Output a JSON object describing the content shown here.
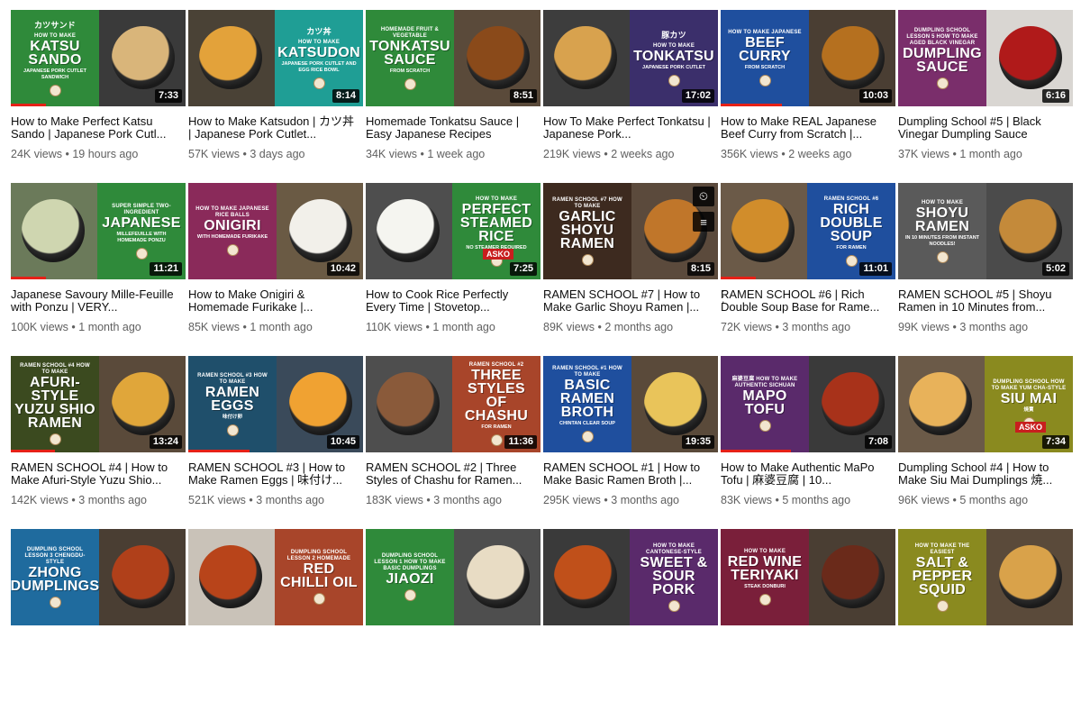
{
  "videos": [
    {
      "title": "How to Make Perfect Katsu Sando | Japanese Pork Cutl...",
      "views": "24K views",
      "age": "19 hours ago",
      "duration": "7:33",
      "thumb_text": {
        "small": "HOW TO MAKE",
        "big": "KATSU SANDO",
        "sub": "JAPANESE PORK CUTLET SANDWICH",
        "jp": "カツサンド"
      },
      "colors": {
        "panel": "#2f8a3a",
        "bg": "#3a3a3a",
        "food": "#d9b57a"
      },
      "progress": 0.2,
      "panel_side": "left"
    },
    {
      "title": "How to Make Katsudon | カツ丼 | Japanese Pork Cutlet...",
      "views": "57K views",
      "age": "3 days ago",
      "duration": "8:14",
      "thumb_text": {
        "small": "HOW TO MAKE",
        "big": "KATSUDON",
        "sub": "JAPANESE PORK CUTLET AND EGG RICE BOWL",
        "jp": "カツ丼"
      },
      "colors": {
        "panel": "#1f9e95",
        "bg": "#4a4236",
        "food": "#e3a23a"
      },
      "progress": 0.0,
      "panel_side": "right"
    },
    {
      "title": "Homemade Tonkatsu Sauce | Easy Japanese Recipes",
      "views": "34K views",
      "age": "1 week ago",
      "duration": "8:51",
      "thumb_text": {
        "small": "HOMEMADE FRUIT & VEGETABLE",
        "big": "TONKATSU SAUCE",
        "sub": "FROM SCRATCH",
        "jp": ""
      },
      "colors": {
        "panel": "#2f8a3a",
        "bg": "#5a4a3a",
        "food": "#8a4a1a"
      },
      "progress": 0.0,
      "panel_side": "left"
    },
    {
      "title": "How To Make Perfect Tonkatsu | Japanese Pork...",
      "views": "219K views",
      "age": "2 weeks ago",
      "duration": "17:02",
      "thumb_text": {
        "small": "HOW TO MAKE",
        "big": "TONKATSU",
        "sub": "JAPANESE PORK CUTLET",
        "jp": "豚カツ"
      },
      "colors": {
        "panel": "#3b2f6b",
        "bg": "#3d3d3d",
        "food": "#d8a24e"
      },
      "progress": 0.0,
      "panel_side": "right"
    },
    {
      "title": "How to Make REAL Japanese Beef Curry from Scratch |...",
      "views": "356K views",
      "age": "2 weeks ago",
      "duration": "10:03",
      "thumb_text": {
        "small": "HOW TO MAKE JAPANESE",
        "big": "BEEF CURRY",
        "sub": "FROM SCRATCH",
        "jp": ""
      },
      "colors": {
        "panel": "#1f4f9e",
        "bg": "#4a3e33",
        "food": "#b5701f"
      },
      "progress": 0.35,
      "panel_side": "left"
    },
    {
      "title": "Dumpling School #5 | Black Vinegar Dumpling Sauce",
      "views": "37K views",
      "age": "1 month ago",
      "duration": "6:16",
      "thumb_text": {
        "small": "DUMPLING SCHOOL LESSON 5 HOW TO MAKE AGED BLACK VINEGAR",
        "big": "DUMPLING SAUCE",
        "sub": "",
        "jp": ""
      },
      "colors": {
        "panel": "#7a2e6b",
        "bg": "#d9d6d2",
        "food": "#b01a1a"
      },
      "progress": 0.0,
      "panel_side": "left"
    },
    {
      "title": "Japanese Savoury Mille-Feuille with Ponzu | VERY...",
      "views": "100K views",
      "age": "1 month ago",
      "duration": "11:21",
      "thumb_text": {
        "small": "SUPER SIMPLE TWO-INGREDIENT",
        "big": "JAPANESE",
        "sub": "MILLEFEUILLE WITH HOMEMADE PONZU",
        "jp": ""
      },
      "colors": {
        "panel": "#2f8a3a",
        "bg": "#6b7a5a",
        "food": "#cfd6b0"
      },
      "progress": 0.2,
      "panel_side": "right"
    },
    {
      "title": "How to Make Onigiri & Homemade Furikake |...",
      "views": "85K views",
      "age": "1 month ago",
      "duration": "10:42",
      "thumb_text": {
        "small": "HOW TO MAKE JAPANESE RICE BALLS",
        "big": "ONIGIRI",
        "sub": "WITH HOMEMADE FURIKAKE",
        "jp": ""
      },
      "colors": {
        "panel": "#8a2a5a",
        "bg": "#6a5a44",
        "food": "#f2f0ea"
      },
      "progress": 0.0,
      "panel_side": "left"
    },
    {
      "title": "How to Cook Rice Perfectly Every Time | Stovetop...",
      "views": "110K views",
      "age": "1 month ago",
      "duration": "7:25",
      "thumb_text": {
        "small": "HOW TO MAKE",
        "big": "PERFECT STEAMED RICE",
        "sub": "NO STEAMER REQUIRED",
        "jp": ""
      },
      "colors": {
        "panel": "#2f8a3a",
        "bg": "#4e4e4e",
        "food": "#f5f5f0"
      },
      "progress": 0.0,
      "panel_side": "right"
    },
    {
      "title": "RAMEN SCHOOL #7 | How to Make Garlic Shoyu Ramen |...",
      "views": "89K views",
      "age": "2 months ago",
      "duration": "8:15",
      "thumb_text": {
        "small": "RAMEN SCHOOL #7 HOW TO MAKE",
        "big": "GARLIC SHOYU RAMEN",
        "sub": "",
        "jp": ""
      },
      "colors": {
        "panel": "#3d2a1f",
        "bg": "#5b4a3c",
        "food": "#c0762a"
      },
      "progress": 0.0,
      "panel_side": "left"
    },
    {
      "title": "RAMEN SCHOOL #6 | Rich Double Soup Base for Rame...",
      "views": "72K views",
      "age": "3 months ago",
      "duration": "11:01",
      "thumb_text": {
        "small": "RAMEN SCHOOL #6",
        "big": "RICH DOUBLE SOUP",
        "sub": "FOR RAMEN",
        "jp": ""
      },
      "colors": {
        "panel": "#1f4f9e",
        "bg": "#6b5a48",
        "food": "#d18d2b"
      },
      "progress": 0.2,
      "panel_side": "right"
    },
    {
      "title": "RAMEN SCHOOL #5 | Shoyu Ramen in 10 Minutes from...",
      "views": "99K views",
      "age": "3 months ago",
      "duration": "5:02",
      "thumb_text": {
        "small": "HOW TO MAKE",
        "big": "SHOYU RAMEN",
        "sub": "IN 10 MINUTES FROM INSTANT NOODLES!",
        "jp": ""
      },
      "colors": {
        "panel": "#5a5a5a",
        "bg": "#4b4b4b",
        "food": "#c48a3a"
      },
      "progress": 0.0,
      "panel_side": "left"
    },
    {
      "title": "RAMEN SCHOOL #4 | How to Make Afuri-Style Yuzu Shio...",
      "views": "142K views",
      "age": "3 months ago",
      "duration": "13:24",
      "thumb_text": {
        "small": "RAMEN SCHOOL #4 HOW TO MAKE",
        "big": "AFURI-STYLE YUZU SHIO RAMEN",
        "sub": "",
        "jp": ""
      },
      "colors": {
        "panel": "#3b4a1f",
        "bg": "#5a4a3a",
        "food": "#e0a63a"
      },
      "progress": 0.25,
      "panel_side": "left"
    },
    {
      "title": "RAMEN SCHOOL #3 | How to Make Ramen Eggs | 味付け...",
      "views": "521K views",
      "age": "3 months ago",
      "duration": "10:45",
      "thumb_text": {
        "small": "RAMEN SCHOOL #3 HOW TO MAKE",
        "big": "RAMEN EGGS",
        "sub": "味付け卵",
        "jp": ""
      },
      "colors": {
        "panel": "#1f4f6b",
        "bg": "#3a4a5a",
        "food": "#f0a232"
      },
      "progress": 0.35,
      "panel_side": "left"
    },
    {
      "title": "RAMEN SCHOOL #2 | Three Styles of Chashu for Ramen...",
      "views": "183K views",
      "age": "3 months ago",
      "duration": "11:36",
      "thumb_text": {
        "small": "RAMEN SCHOOL #2",
        "big": "THREE STYLES OF CHASHU",
        "sub": "FOR RAMEN",
        "jp": ""
      },
      "colors": {
        "panel": "#a8452a",
        "bg": "#4e4e4e",
        "food": "#8a5a3a"
      },
      "progress": 0.0,
      "panel_side": "right"
    },
    {
      "title": "RAMEN SCHOOL #1 | How to Make Basic Ramen Broth |...",
      "views": "295K views",
      "age": "3 months ago",
      "duration": "19:35",
      "thumb_text": {
        "small": "RAMEN SCHOOL #1 HOW TO MAKE",
        "big": "BASIC RAMEN BROTH",
        "sub": "CHINTAN CLEAR SOUP",
        "jp": ""
      },
      "colors": {
        "panel": "#1f4f9e",
        "bg": "#5a4a3a",
        "food": "#e9c45a"
      },
      "progress": 0.0,
      "panel_side": "left"
    },
    {
      "title": "How to Make Authentic MaPo Tofu | 麻婆豆腐 | 10...",
      "views": "83K views",
      "age": "5 months ago",
      "duration": "7:08",
      "thumb_text": {
        "small": "麻婆豆腐 HOW TO MAKE AUTHENTIC SICHUAN",
        "big": "MAPO TOFU",
        "sub": "",
        "jp": ""
      },
      "colors": {
        "panel": "#5a2a6b",
        "bg": "#3a3a3a",
        "food": "#a8321a"
      },
      "progress": 0.4,
      "panel_side": "left"
    },
    {
      "title": "Dumpling School #4 | How to Make Siu Mai Dumplings 焼...",
      "views": "96K views",
      "age": "5 months ago",
      "duration": "7:34",
      "thumb_text": {
        "small": "DUMPLING SCHOOL HOW TO MAKE YUM CHA-STYLE",
        "big": "SIU MAI",
        "sub": "焼賣",
        "jp": ""
      },
      "colors": {
        "panel": "#8a8a1f",
        "bg": "#6b5a48",
        "food": "#e8b25a"
      },
      "progress": 0.0,
      "panel_side": "right"
    },
    {
      "title": "",
      "views": "",
      "age": "",
      "duration": "",
      "thumb_text": {
        "small": "DUMPLING SCHOOL LESSON 3 CHENGDU-STYLE",
        "big": "ZHONG DUMPLINGS",
        "sub": "",
        "jp": ""
      },
      "colors": {
        "panel": "#1f6b9e",
        "bg": "#4a3e33",
        "food": "#b0401a"
      },
      "progress": 0.0,
      "panel_side": "left"
    },
    {
      "title": "",
      "views": "",
      "age": "",
      "duration": "",
      "thumb_text": {
        "small": "DUMPLING SCHOOL LESSON 2 HOMEMADE",
        "big": "RED CHILLI OIL",
        "sub": "",
        "jp": ""
      },
      "colors": {
        "panel": "#a8452a",
        "bg": "#c9c2b8",
        "food": "#b8441a"
      },
      "progress": 0.0,
      "panel_side": "right"
    },
    {
      "title": "",
      "views": "",
      "age": "",
      "duration": "",
      "thumb_text": {
        "small": "DUMPLING SCHOOL LESSON 1 HOW TO MAKE BASIC DUMPLINGS",
        "big": "JIAOZI",
        "sub": "",
        "jp": ""
      },
      "colors": {
        "panel": "#2f8a3a",
        "bg": "#4e4e4e",
        "food": "#e8dcc4"
      },
      "progress": 0.0,
      "panel_side": "left"
    },
    {
      "title": "",
      "views": "",
      "age": "",
      "duration": "",
      "thumb_text": {
        "small": "HOW TO MAKE CANTONESE-STYLE",
        "big": "SWEET & SOUR PORK",
        "sub": "",
        "jp": ""
      },
      "colors": {
        "panel": "#5a2a6b",
        "bg": "#3a3a3a",
        "food": "#c0501a"
      },
      "progress": 0.0,
      "panel_side": "right"
    },
    {
      "title": "",
      "views": "",
      "age": "",
      "duration": "",
      "thumb_text": {
        "small": "HOW TO MAKE",
        "big": "RED WINE TERIYAKI",
        "sub": "STEAK DONBURI",
        "jp": ""
      },
      "colors": {
        "panel": "#7a1f3a",
        "bg": "#4a3e33",
        "food": "#6a2a1a"
      },
      "progress": 0.0,
      "panel_side": "left"
    },
    {
      "title": "",
      "views": "",
      "age": "",
      "duration": "",
      "thumb_text": {
        "small": "HOW TO MAKE THE EASIEST",
        "big": "SALT & PEPPER SQUID",
        "sub": "",
        "jp": ""
      },
      "colors": {
        "panel": "#8a8a1f",
        "bg": "#5a4a3a",
        "food": "#d9a24a"
      },
      "progress": 0.0,
      "panel_side": "left"
    }
  ],
  "hover_card_index": 9,
  "hover_icons": [
    "clock-icon",
    "queue-icon"
  ],
  "brand_badge": "ASKO"
}
